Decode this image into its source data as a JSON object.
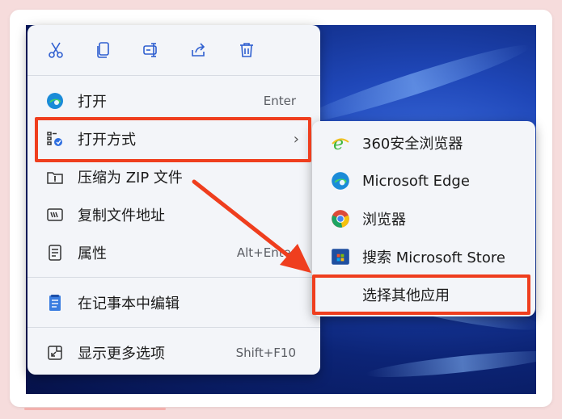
{
  "colors": {
    "highlight": "#ef3e1e",
    "menu_bg": "#f3f5f9",
    "accent_line": "#f3b0ad"
  },
  "toolbar": {
    "icons": [
      "cut-icon",
      "copy-icon",
      "rename-icon",
      "share-icon",
      "delete-icon"
    ]
  },
  "menu": {
    "open": {
      "label": "打开",
      "shortcut": "Enter"
    },
    "open_with": {
      "label": "打开方式"
    },
    "compress": {
      "label": "压缩为 ZIP 文件"
    },
    "copy_path": {
      "label": "复制文件地址"
    },
    "properties": {
      "label": "属性",
      "shortcut": "Alt+Enter"
    },
    "notepad": {
      "label": "在记事本中编辑"
    },
    "more": {
      "label": "显示更多选项",
      "shortcut": "Shift+F10"
    }
  },
  "submenu": {
    "items": [
      {
        "label": "360安全浏览器"
      },
      {
        "label": "Microsoft Edge"
      },
      {
        "label": "浏览器"
      },
      {
        "label": "搜索 Microsoft Store"
      },
      {
        "label": "选择其他应用"
      }
    ]
  }
}
